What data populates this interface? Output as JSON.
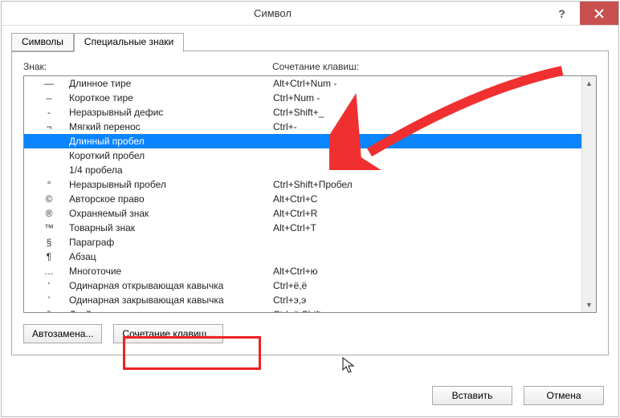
{
  "title": "Символ",
  "tabs": {
    "symbols": "Символы",
    "special": "Специальные знаки"
  },
  "headers": {
    "znak": "Знак:",
    "shortcut": "Сочетание клавиш:"
  },
  "rows": [
    {
      "sym": "—",
      "name": "Длинное тире",
      "key": "Alt+Ctrl+Num -",
      "sel": false
    },
    {
      "sym": "–",
      "name": "Короткое тире",
      "key": "Ctrl+Num -",
      "sel": false
    },
    {
      "sym": "-",
      "name": "Неразрывный дефис",
      "key": "Ctrl+Shift+_",
      "sel": false
    },
    {
      "sym": "¬",
      "name": "Мягкий перенос",
      "key": "Ctrl+-",
      "sel": false
    },
    {
      "sym": "",
      "name": "Длинный пробел",
      "key": "",
      "sel": true
    },
    {
      "sym": "",
      "name": "Короткий пробел",
      "key": "",
      "sel": false
    },
    {
      "sym": "",
      "name": "1/4 пробела",
      "key": "",
      "sel": false
    },
    {
      "sym": "°",
      "name": "Неразрывный пробел",
      "key": "Ctrl+Shift+Пробел",
      "sel": false
    },
    {
      "sym": "©",
      "name": "Авторское право",
      "key": "Alt+Ctrl+C",
      "sel": false
    },
    {
      "sym": "®",
      "name": "Охраняемый знак",
      "key": "Alt+Ctrl+R",
      "sel": false
    },
    {
      "sym": "™",
      "name": "Товарный знак",
      "key": "Alt+Ctrl+T",
      "sel": false
    },
    {
      "sym": "§",
      "name": "Параграф",
      "key": "",
      "sel": false
    },
    {
      "sym": "¶",
      "name": "Абзац",
      "key": "",
      "sel": false
    },
    {
      "sym": "…",
      "name": "Многоточие",
      "key": "Alt+Ctrl+ю",
      "sel": false
    },
    {
      "sym": "‘",
      "name": "Одинарная открывающая кавычка",
      "key": "Ctrl+ё,ё",
      "sel": false
    },
    {
      "sym": "’",
      "name": "Одинарная закрывающая кавычка",
      "key": "Ctrl+э,э",
      "sel": false
    },
    {
      "sym": "‟",
      "name": "Двойная открывающая кавычка",
      "key": "Ctrl+ё,Shift+э",
      "sel": false
    }
  ],
  "buttons": {
    "autocorrect": "Автозамена...",
    "shortcut": "Сочетание клавиш...",
    "insert": "Вставить",
    "cancel": "Отмена"
  }
}
